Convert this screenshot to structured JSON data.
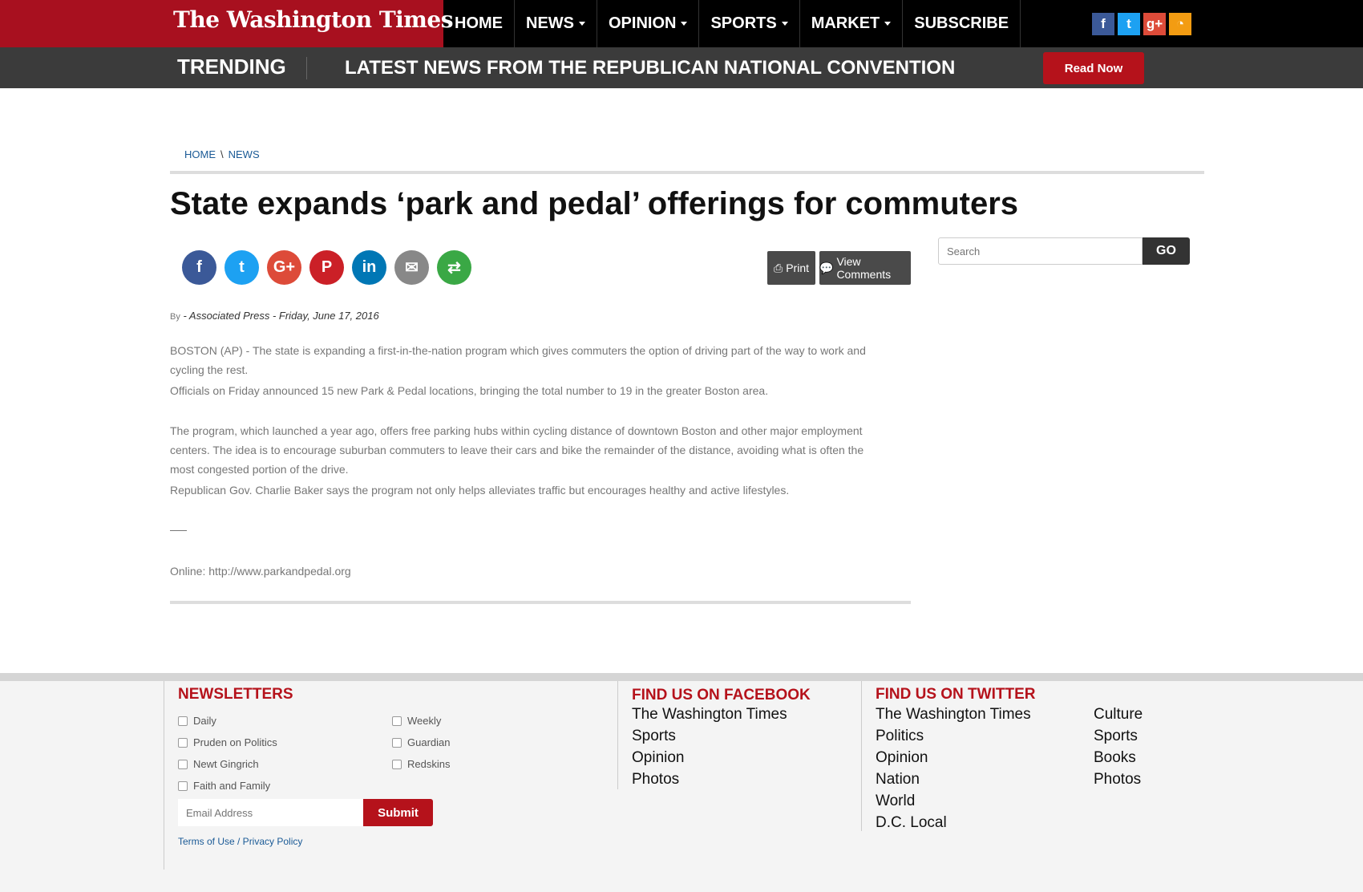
{
  "header": {
    "logo": "The Washington Times",
    "nav": [
      {
        "label": "HOME",
        "dropdown": false
      },
      {
        "label": "NEWS",
        "dropdown": true
      },
      {
        "label": "OPINION",
        "dropdown": true
      },
      {
        "label": "SPORTS",
        "dropdown": true
      },
      {
        "label": "MARKET",
        "dropdown": true
      },
      {
        "label": "SUBSCRIBE",
        "dropdown": false
      }
    ],
    "social": [
      {
        "icon": "facebook-icon",
        "glyph": "f",
        "color": "#3b5998"
      },
      {
        "icon": "twitter-icon",
        "glyph": "t",
        "color": "#1da1f2"
      },
      {
        "icon": "google-plus-icon",
        "glyph": "g+",
        "color": "#dd4b39"
      },
      {
        "icon": "rss-icon",
        "glyph": "◔",
        "color": "#f39c12"
      }
    ]
  },
  "trending": {
    "label": "TRENDING",
    "headline": "LATEST NEWS FROM THE REPUBLICAN NATIONAL CONVENTION",
    "button": "Read Now"
  },
  "breadcrumb": {
    "home": "HOME",
    "sep": "\\",
    "section": "NEWS"
  },
  "article": {
    "title": "State expands ‘park and pedal’ offerings for commuters",
    "share": [
      {
        "icon": "facebook-share-icon",
        "glyph": "f",
        "color": "#3b5998"
      },
      {
        "icon": "twitter-share-icon",
        "glyph": "t",
        "color": "#1da1f2"
      },
      {
        "icon": "google-plus-share-icon",
        "glyph": "G+",
        "color": "#dd4b39"
      },
      {
        "icon": "pinterest-share-icon",
        "glyph": "P",
        "color": "#cb2027"
      },
      {
        "icon": "linkedin-share-icon",
        "glyph": "in",
        "color": "#0077b5"
      },
      {
        "icon": "email-share-icon",
        "glyph": "✉",
        "color": "#888888"
      },
      {
        "icon": "more-share-icon",
        "glyph": "⇄",
        "color": "#3aa845"
      }
    ],
    "print_label": "Print",
    "comments_label": "View Comments",
    "by": "By",
    "byline": "- Associated Press - Friday, June 17, 2016",
    "paragraphs": [
      "BOSTON (AP) - The state is expanding a first-in-the-nation program which gives commuters the option of driving part of the way to work and cycling the rest.",
      "Officials on Friday announced 15 new Park & Pedal locations, bringing the total number to 19 in the greater Boston area.",
      "The program, which launched a year ago, offers free parking hubs within cycling distance of downtown Boston and other major employment centers. The idea is to encourage suburban commuters to leave their cars and bike the remainder of the distance, avoiding what is often the most congested portion of the drive.",
      "Republican Gov. Charlie Baker says the program not only helps alleviates traffic but encourages healthy and active lifestyles.",
      "Online: http://www.parkandpedal.org"
    ]
  },
  "search": {
    "placeholder": "Search",
    "button": "GO"
  },
  "footer": {
    "newsletters": {
      "heading": "NEWSLETTERS",
      "left": [
        "Daily",
        "Pruden on Politics",
        "Newt Gingrich",
        "Faith and Family"
      ],
      "right": [
        "Weekly",
        "Guardian",
        "Redskins"
      ],
      "email_placeholder": "Email Address",
      "submit": "Submit",
      "terms": "Terms of Use / Privacy Policy"
    },
    "facebook": {
      "heading": "FIND US ON FACEBOOK",
      "links": [
        "The Washington Times",
        "Sports",
        "Opinion",
        "Photos"
      ]
    },
    "twitter": {
      "heading": "FIND US ON TWITTER",
      "links_left": [
        "The Washington Times",
        "Politics",
        "Opinion",
        "Nation",
        "World",
        "D.C. Local"
      ],
      "links_right": [
        "Culture",
        "Sports",
        "Books",
        "Photos"
      ]
    }
  }
}
